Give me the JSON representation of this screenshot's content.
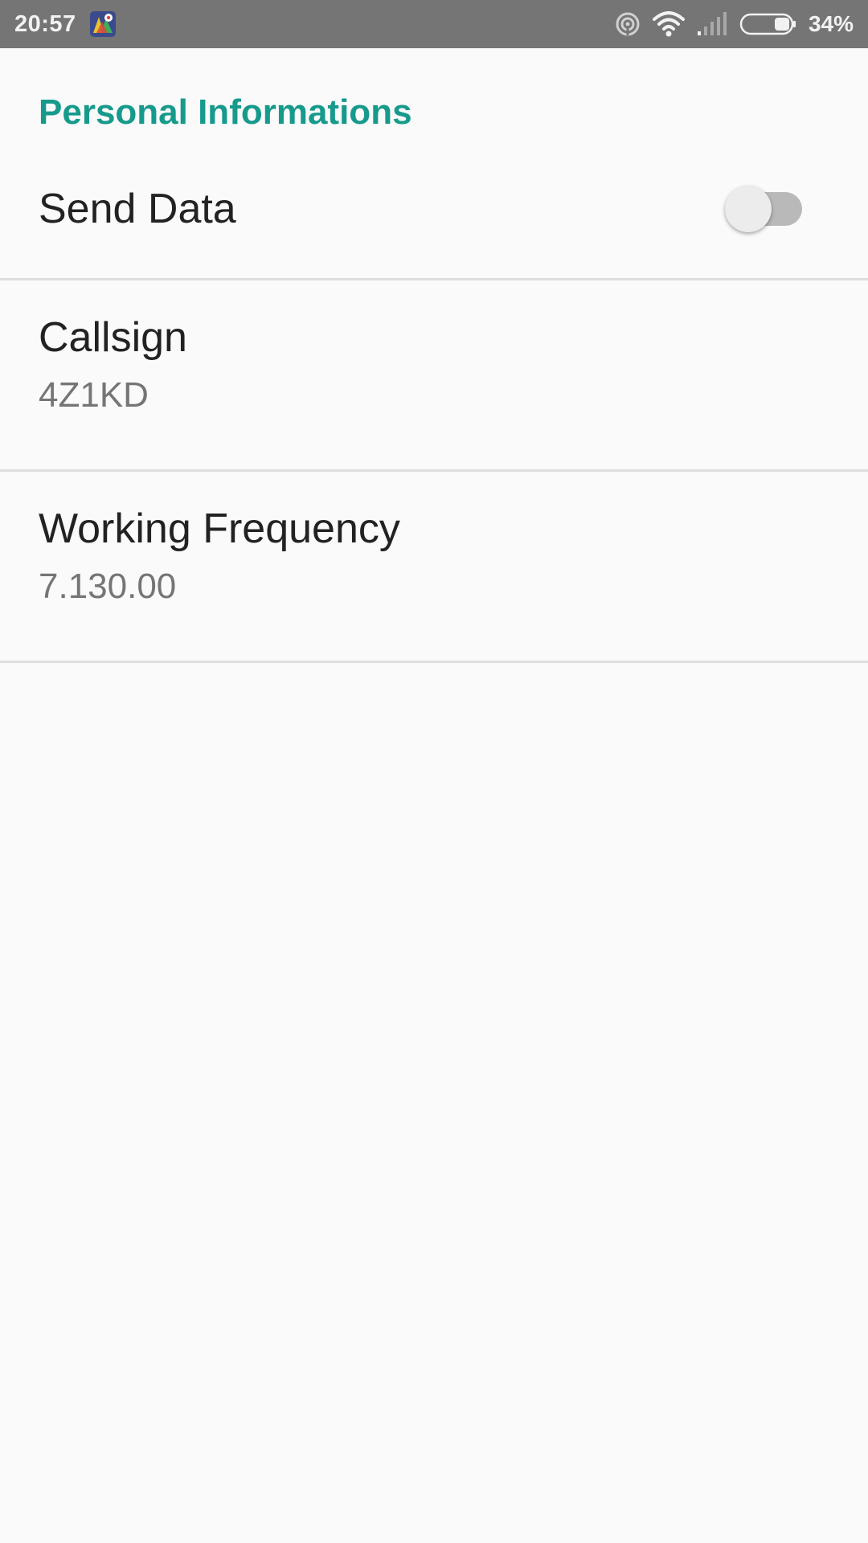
{
  "status_bar": {
    "time": "20:57",
    "battery_percent": "34%",
    "app_icon": "map-pin-app-icon",
    "icons": [
      "hotspot-icon",
      "wifi-icon",
      "signal-icon",
      "battery-icon"
    ]
  },
  "preferences": {
    "category_title": "Personal Informations",
    "send_data": {
      "title": "Send Data",
      "enabled": false
    },
    "callsign": {
      "title": "Callsign",
      "value": "4Z1KD"
    },
    "working_frequency": {
      "title": "Working Frequency",
      "value": "7.130.00"
    }
  },
  "colors": {
    "accent": "#169a8c",
    "status_bar": "#757575",
    "background": "#fafafa",
    "divider": "#dedede"
  }
}
